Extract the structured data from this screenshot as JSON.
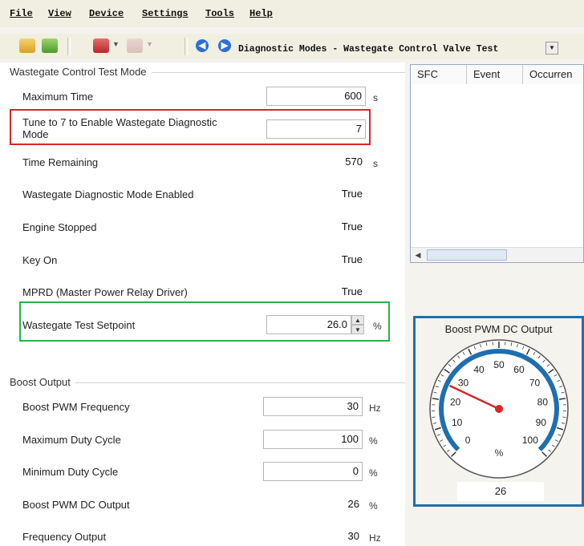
{
  "menu": [
    "File",
    "View",
    "Device",
    "Settings",
    "Tools",
    "Help"
  ],
  "toolbar": {
    "mode_selector_value": "Diagnostic Modes - Wastegate Control Valve Test"
  },
  "wastegate_group": {
    "title": "Wastegate Control Test Mode",
    "rows": [
      {
        "label": "Maximum Time",
        "value": "600",
        "unit": "s"
      },
      {
        "label": "Tune to 7 to Enable Wastegate Diagnostic Mode",
        "value": "7",
        "unit": ""
      },
      {
        "label": "Time Remaining",
        "value": "570",
        "unit": "s"
      },
      {
        "label": "Wastegate Diagnostic Mode Enabled",
        "value": "True",
        "unit": ""
      },
      {
        "label": "Engine Stopped",
        "value": "True",
        "unit": ""
      },
      {
        "label": "Key On",
        "value": "True",
        "unit": ""
      },
      {
        "label": "MPRD (Master Power Relay Driver)",
        "value": "True",
        "unit": ""
      },
      {
        "label": "Wastegate Test Setpoint",
        "value": "26.0",
        "unit": "%"
      }
    ]
  },
  "boost_group": {
    "title": "Boost Output",
    "rows": [
      {
        "label": "Boost PWM Frequency",
        "value": "30",
        "unit": "Hz"
      },
      {
        "label": "Maximum Duty Cycle",
        "value": "100",
        "unit": "%"
      },
      {
        "label": "Minimum Duty Cycle",
        "value": "0",
        "unit": "%"
      },
      {
        "label": "Boost PWM DC Output",
        "value": "26",
        "unit": "%"
      },
      {
        "label": "Frequency Output",
        "value": "30",
        "unit": "Hz"
      }
    ]
  },
  "fault_table": {
    "columns": [
      "SFC",
      "Event",
      "Occurren"
    ]
  },
  "gauge": {
    "title": "Boost PWM DC Output",
    "ticks": [
      "0",
      "10",
      "20",
      "30",
      "40",
      "50",
      "60",
      "70",
      "80",
      "90",
      "100"
    ],
    "unit": "%",
    "value": 26,
    "value_text": "26",
    "accent_color": "#1f6fae",
    "needle_color": "#d9252a"
  }
}
